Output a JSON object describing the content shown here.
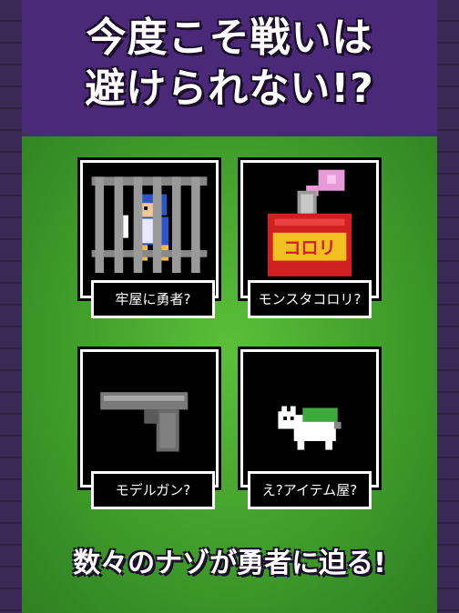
{
  "header": {
    "line1": "今度こそ戦いは",
    "line2": "避けられない!?"
  },
  "items": [
    {
      "caption": "牢屋に勇者?"
    },
    {
      "caption": "モンスタコロリ?",
      "label_on_bottle": "コロリ"
    },
    {
      "caption": "モデルガン?"
    },
    {
      "caption": "え?アイテム屋?"
    }
  ],
  "footer": {
    "tagline": "数々のナゾが勇者に迫る!"
  },
  "colors": {
    "header_bg": "#4a2a78",
    "field_bg": "#3f9d2a",
    "tile_bg": "#000000",
    "tile_border": "#ffffff"
  }
}
